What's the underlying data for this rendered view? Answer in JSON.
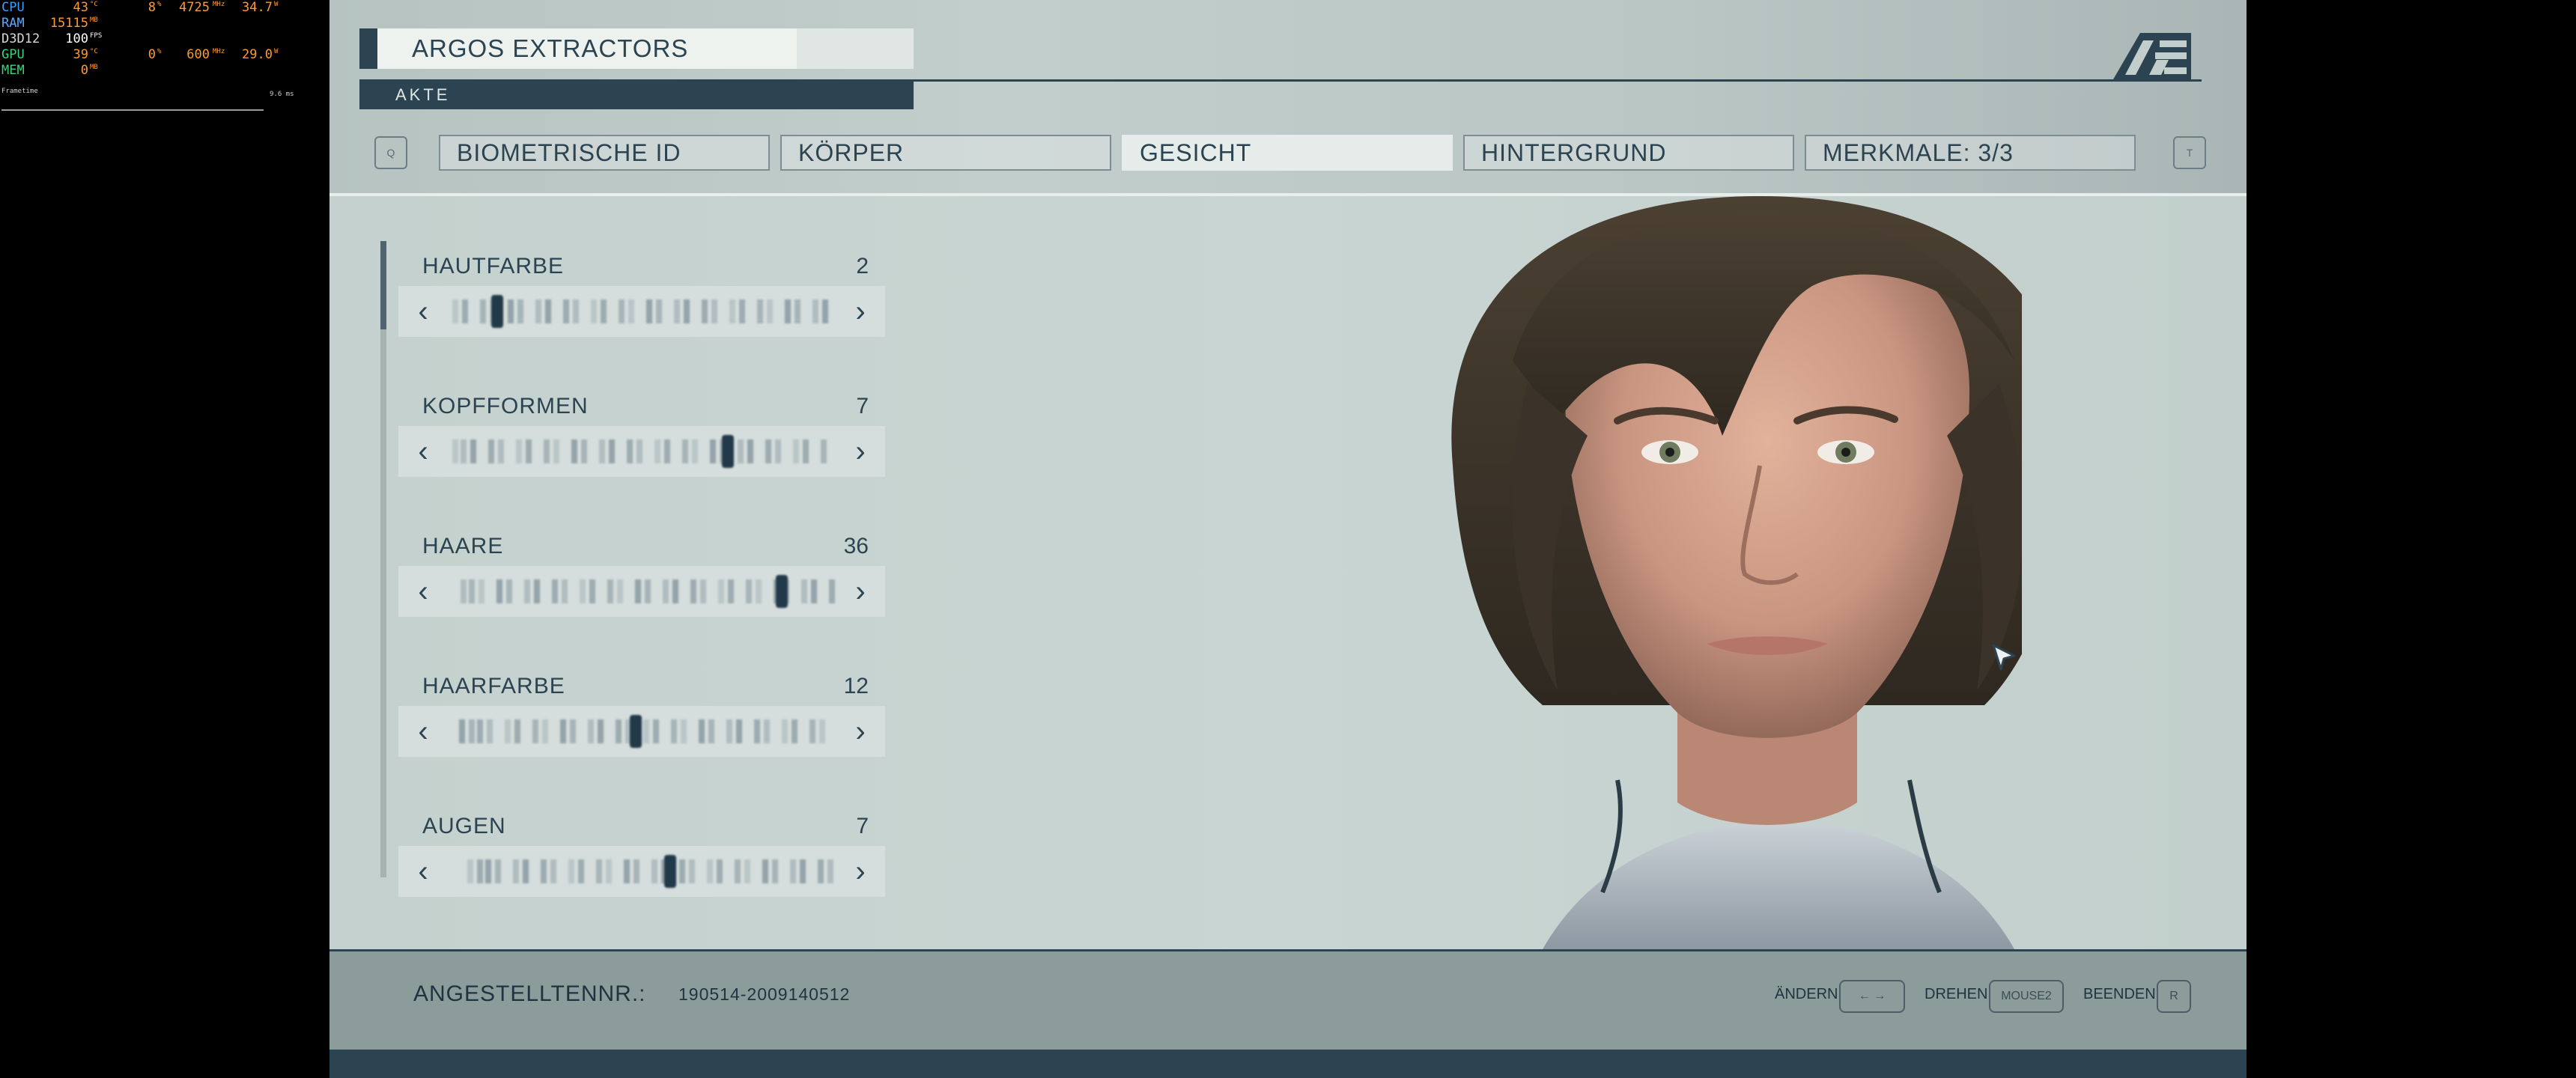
{
  "overlay": {
    "rows": [
      {
        "label": "CPU",
        "v1": "43",
        "u1": "°C",
        "v2": "8",
        "u2": "%",
        "v3": "4725",
        "u3": "MHz",
        "v4": "34.7",
        "u4": "W"
      },
      {
        "label": "RAM",
        "v1": "15115",
        "u1": "MB"
      },
      {
        "label": "D3D12",
        "v1": "100",
        "u1": "FPS"
      },
      {
        "label": "GPU",
        "v1": "39",
        "u1": "°C",
        "v2": "0",
        "u2": "%",
        "v3": "600",
        "u3": "MHz",
        "v4": "29.0",
        "u4": "W"
      },
      {
        "label": "MEM",
        "v1": "0",
        "u1": "MB"
      }
    ],
    "frametime_label": "Frametime",
    "frametime_value": "9.6 ms"
  },
  "header": {
    "corp_name": "ARGOS EXTRACTORS",
    "file_label": "AKTE",
    "logo_icon": "ae-logo-icon",
    "left_key": "Q",
    "right_key": "T",
    "tabs": [
      {
        "label": "BIOMETRISCHE ID",
        "active": false
      },
      {
        "label": "KÖRPER",
        "active": false
      },
      {
        "label": "GESICHT",
        "active": true
      },
      {
        "label": "HINTERGRUND",
        "active": false
      },
      {
        "label": "MERKMALE: 3/3",
        "active": false
      }
    ]
  },
  "sliders": [
    {
      "label": "HAUTFARBE",
      "value": "2",
      "position": 0.12
    },
    {
      "label": "KOPFFORMEN",
      "value": "7",
      "position": 0.72
    },
    {
      "label": "HAARE",
      "value": "36",
      "position": 0.86
    },
    {
      "label": "HAARFARBE",
      "value": "12",
      "position": 0.48
    },
    {
      "label": "AUGEN",
      "value": "7",
      "position": 0.57
    }
  ],
  "footer": {
    "employee_label": "ANGESTELLTENNR.:",
    "employee_value": "190514-2009140512",
    "hints": [
      {
        "label": "ÄNDERN",
        "key": "← →"
      },
      {
        "label": "DREHEN",
        "key": "MOUSE2"
      },
      {
        "label": "BEENDEN",
        "key": "R"
      }
    ]
  },
  "colors": {
    "accent": "#2c4452",
    "panel": "#c5d2cf",
    "bottom_bar": "#8c9c9b",
    "overlay_orange": "#ff9a2e"
  }
}
